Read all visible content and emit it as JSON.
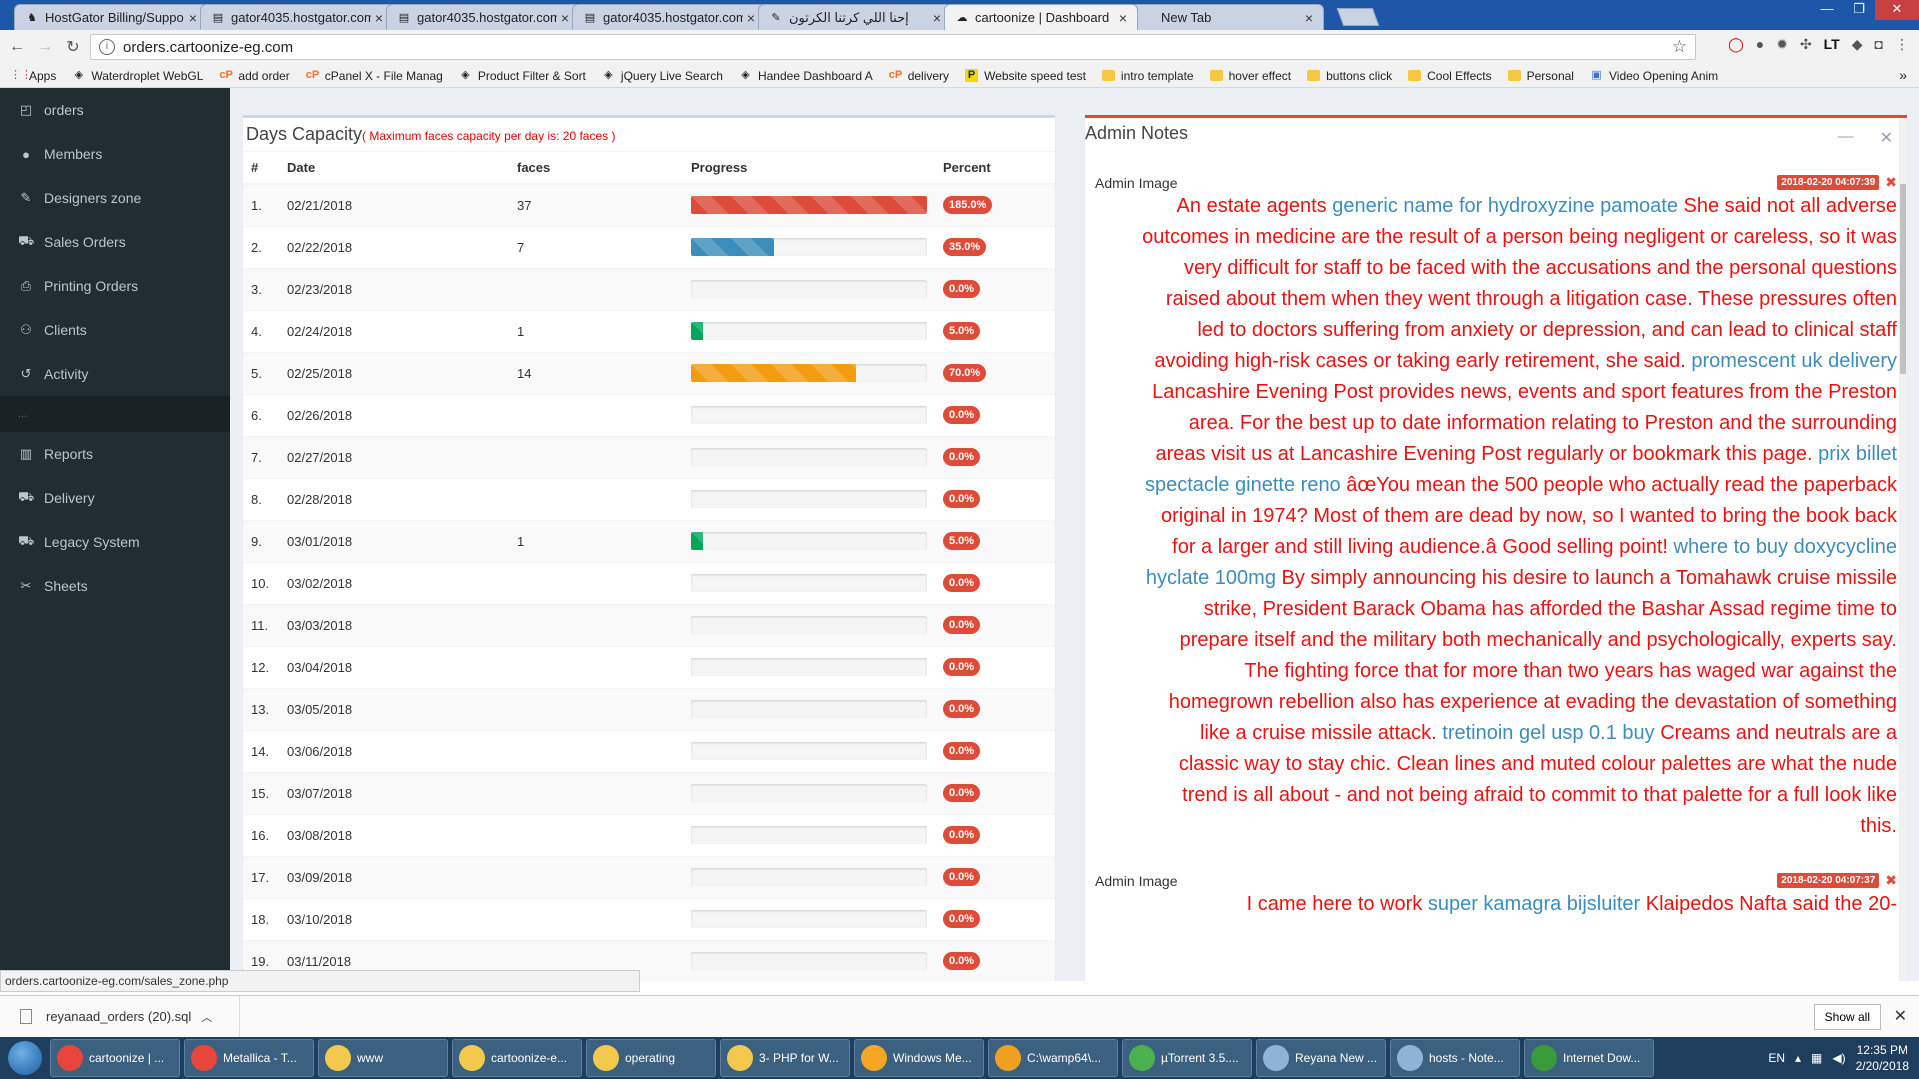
{
  "browser": {
    "tabs": [
      {
        "title": "HostGator Billing/Suppo",
        "fav": "♞",
        "active": false
      },
      {
        "title": "gator4035.hostgator.com",
        "fav": "▤",
        "active": false
      },
      {
        "title": "gator4035.hostgator.com",
        "fav": "▤",
        "active": false
      },
      {
        "title": "gator4035.hostgator.com",
        "fav": "▤",
        "active": false
      },
      {
        "title": "إحنا اللي كرتنا الكرتون",
        "fav": "✎",
        "active": false
      },
      {
        "title": "cartoonize | Dashboard",
        "fav": "☁",
        "active": true
      },
      {
        "title": "New Tab",
        "fav": "",
        "active": false
      }
    ],
    "url": "orders.cartoonize-eg.com",
    "status_url": "orders.cartoonize-eg.com/sales_zone.php",
    "bookmarks": [
      {
        "label": "Apps",
        "icon": "apps-icon"
      },
      {
        "label": "Waterdroplet WebGL",
        "icon": "codepen-icon"
      },
      {
        "label": "add order",
        "icon": "cpanel-icon"
      },
      {
        "label": "cPanel X - File Manag",
        "icon": "cpanel-icon"
      },
      {
        "label": "Product Filter & Sort",
        "icon": "codepen-icon"
      },
      {
        "label": "jQuery Live Search",
        "icon": "codepen-icon"
      },
      {
        "label": "Handee Dashboard A",
        "icon": "codepen-icon"
      },
      {
        "label": "delivery",
        "icon": "cpanel-icon"
      },
      {
        "label": "Website speed test",
        "icon": "pingdom-icon"
      },
      {
        "label": "intro template",
        "icon": "folder-icon"
      },
      {
        "label": "hover effect",
        "icon": "folder-icon"
      },
      {
        "label": "buttons click",
        "icon": "folder-icon"
      },
      {
        "label": "Cool Effects",
        "icon": "folder-icon"
      },
      {
        "label": "Personal",
        "icon": "folder-icon"
      },
      {
        "label": "Video Opening Anim",
        "icon": "page-icon"
      }
    ]
  },
  "sidebar": {
    "items": [
      {
        "label": "orders",
        "icon": "clipboard-icon",
        "glyph": "◰"
      },
      {
        "label": "Members",
        "icon": "user-icon",
        "glyph": "●"
      },
      {
        "label": "Designers zone",
        "icon": "brush-icon",
        "glyph": "✎"
      },
      {
        "label": "Sales Orders",
        "icon": "cart-icon",
        "glyph": "⛟"
      },
      {
        "label": "Printing Orders",
        "icon": "print-icon",
        "glyph": "⎙"
      },
      {
        "label": "Clients",
        "icon": "users-icon",
        "glyph": "⚇"
      },
      {
        "label": "Activity",
        "icon": "history-icon",
        "glyph": "↺"
      },
      {
        "label": "...",
        "icon": "",
        "glyph": "",
        "sep": true
      },
      {
        "label": "Reports",
        "icon": "bar-chart-icon",
        "glyph": "▥"
      },
      {
        "label": "Delivery",
        "icon": "truck-icon",
        "glyph": "⛟"
      },
      {
        "label": "Legacy System",
        "icon": "cart-icon",
        "glyph": "⛟"
      },
      {
        "label": "Sheets",
        "icon": "paperclip-icon",
        "glyph": "✂"
      }
    ]
  },
  "capacity": {
    "title": "Days Capacity",
    "subtitle": "( Maximum faces capacity per day is: 20 faces )",
    "columns": [
      "#",
      "Date",
      "faces",
      "Progress",
      "Percent"
    ],
    "rows": [
      {
        "n": "1.",
        "date": "02/21/2018",
        "faces": "37",
        "pct": "185.0%",
        "fill": 1.0,
        "color": "#dd4b39"
      },
      {
        "n": "2.",
        "date": "02/22/2018",
        "faces": "7",
        "pct": "35.0%",
        "fill": 0.35,
        "color": "#3c8dbc"
      },
      {
        "n": "3.",
        "date": "02/23/2018",
        "faces": "",
        "pct": "0.0%",
        "fill": 0,
        "color": "#00a65a"
      },
      {
        "n": "4.",
        "date": "02/24/2018",
        "faces": "1",
        "pct": "5.0%",
        "fill": 0.05,
        "color": "#00a65a"
      },
      {
        "n": "5.",
        "date": "02/25/2018",
        "faces": "14",
        "pct": "70.0%",
        "fill": 0.7,
        "color": "#f39c12"
      },
      {
        "n": "6.",
        "date": "02/26/2018",
        "faces": "",
        "pct": "0.0%",
        "fill": 0,
        "color": "#00a65a"
      },
      {
        "n": "7.",
        "date": "02/27/2018",
        "faces": "",
        "pct": "0.0%",
        "fill": 0,
        "color": "#00a65a"
      },
      {
        "n": "8.",
        "date": "02/28/2018",
        "faces": "",
        "pct": "0.0%",
        "fill": 0,
        "color": "#00a65a"
      },
      {
        "n": "9.",
        "date": "03/01/2018",
        "faces": "1",
        "pct": "5.0%",
        "fill": 0.05,
        "color": "#00a65a"
      },
      {
        "n": "10.",
        "date": "03/02/2018",
        "faces": "",
        "pct": "0.0%",
        "fill": 0,
        "color": "#00a65a"
      },
      {
        "n": "11.",
        "date": "03/03/2018",
        "faces": "",
        "pct": "0.0%",
        "fill": 0,
        "color": "#00a65a"
      },
      {
        "n": "12.",
        "date": "03/04/2018",
        "faces": "",
        "pct": "0.0%",
        "fill": 0,
        "color": "#00a65a"
      },
      {
        "n": "13.",
        "date": "03/05/2018",
        "faces": "",
        "pct": "0.0%",
        "fill": 0,
        "color": "#00a65a"
      },
      {
        "n": "14.",
        "date": "03/06/2018",
        "faces": "",
        "pct": "0.0%",
        "fill": 0,
        "color": "#00a65a"
      },
      {
        "n": "15.",
        "date": "03/07/2018",
        "faces": "",
        "pct": "0.0%",
        "fill": 0,
        "color": "#00a65a"
      },
      {
        "n": "16.",
        "date": "03/08/2018",
        "faces": "",
        "pct": "0.0%",
        "fill": 0,
        "color": "#00a65a"
      },
      {
        "n": "17.",
        "date": "03/09/2018",
        "faces": "",
        "pct": "0.0%",
        "fill": 0,
        "color": "#00a65a"
      },
      {
        "n": "18.",
        "date": "03/10/2018",
        "faces": "",
        "pct": "0.0%",
        "fill": 0,
        "color": "#00a65a"
      },
      {
        "n": "19.",
        "date": "03/11/2018",
        "faces": "",
        "pct": "0.0%",
        "fill": 0,
        "color": "#00a65a"
      }
    ]
  },
  "notes": {
    "title": "Admin Notes",
    "items": [
      {
        "image_alt": "Admin Image",
        "date": "2018-02-20 04:07:39",
        "parts": [
          {
            "t": "An estate agents ",
            "link": false
          },
          {
            "t": "generic name for hydroxyzine pamoate",
            "link": true
          },
          {
            "t": " She said not all adverse outcomes in medicine are the result of a person being negligent or careless, so it was very difficult for staff to be faced with the accusations and the personal questions raised about them when they went through a litigation case. These pressures often led to doctors suffering from anxiety or depression, and can lead to clinical staff avoiding high-risk cases or taking early retirement, she said. ",
            "link": false
          },
          {
            "t": "promescent uk delivery",
            "link": true
          },
          {
            "t": " Lancashire Evening Post provides news, events and sport features from the Preston area. For the best up to date information relating to Preston and the surrounding areas visit us at Lancashire Evening Post regularly or bookmark this page. ",
            "link": false
          },
          {
            "t": "prix billet spectacle ginette reno",
            "link": true
          },
          {
            "t": " âœYou mean the 500 people who actually read the paperback original in 1974? Most of them are dead by now, so I wanted to bring the book back for a larger and still living audience.â Good selling point! ",
            "link": false
          },
          {
            "t": "where to buy doxycycline hyclate 100mg",
            "link": true
          },
          {
            "t": " By simply announcing his desire to launch a Tomahawk cruise missile strike, President Barack Obama has afforded the Bashar Assad regime time to prepare itself and the military both mechanically and psychologically, experts say. The fighting force that for more than two years has waged war against the homegrown rebellion also has experience at evading the devastation of something like a cruise missile attack. ",
            "link": false
          },
          {
            "t": "tretinoin gel usp 0.1 buy",
            "link": true
          },
          {
            "t": " Creams and neutrals are a classic way to stay chic. Clean lines and muted colour palettes are what the nude trend is all about - and not being afraid to commit to that palette for a full look like this.",
            "link": false
          }
        ]
      },
      {
        "image_alt": "Admin Image",
        "date": "2018-02-20 04:07:37",
        "parts": [
          {
            "t": "I came here to work ",
            "link": false
          },
          {
            "t": "super kamagra bijsluiter",
            "link": true
          },
          {
            "t": " Klaipedos Nafta said the 20-",
            "link": false
          }
        ]
      }
    ]
  },
  "downloads": {
    "file": "reyanaad_orders (20).sql",
    "show_all": "Show all"
  },
  "taskbar": {
    "items": [
      {
        "label": "cartoonize | ...",
        "color": "#e8453c"
      },
      {
        "label": "Metallica - T...",
        "color": "#e8453c"
      },
      {
        "label": "www",
        "color": "#f2c94c"
      },
      {
        "label": "cartoonize-e...",
        "color": "#f2c94c"
      },
      {
        "label": "operating",
        "color": "#f2c94c"
      },
      {
        "label": "3- PHP for W...",
        "color": "#f2c94c"
      },
      {
        "label": "Windows Me...",
        "color": "#f5a623"
      },
      {
        "label": "C:\\wamp64\\...",
        "color": "#f0a020"
      },
      {
        "label": "µTorrent 3.5....",
        "color": "#4caf50"
      },
      {
        "label": "Reyana New ...",
        "color": "#8fb3d6"
      },
      {
        "label": "hosts - Note...",
        "color": "#8fb3d6"
      },
      {
        "label": "Internet Dow...",
        "color": "#3a9b3a"
      }
    ],
    "lang": "EN",
    "time": "12:35 PM",
    "date": "2/20/2018"
  }
}
